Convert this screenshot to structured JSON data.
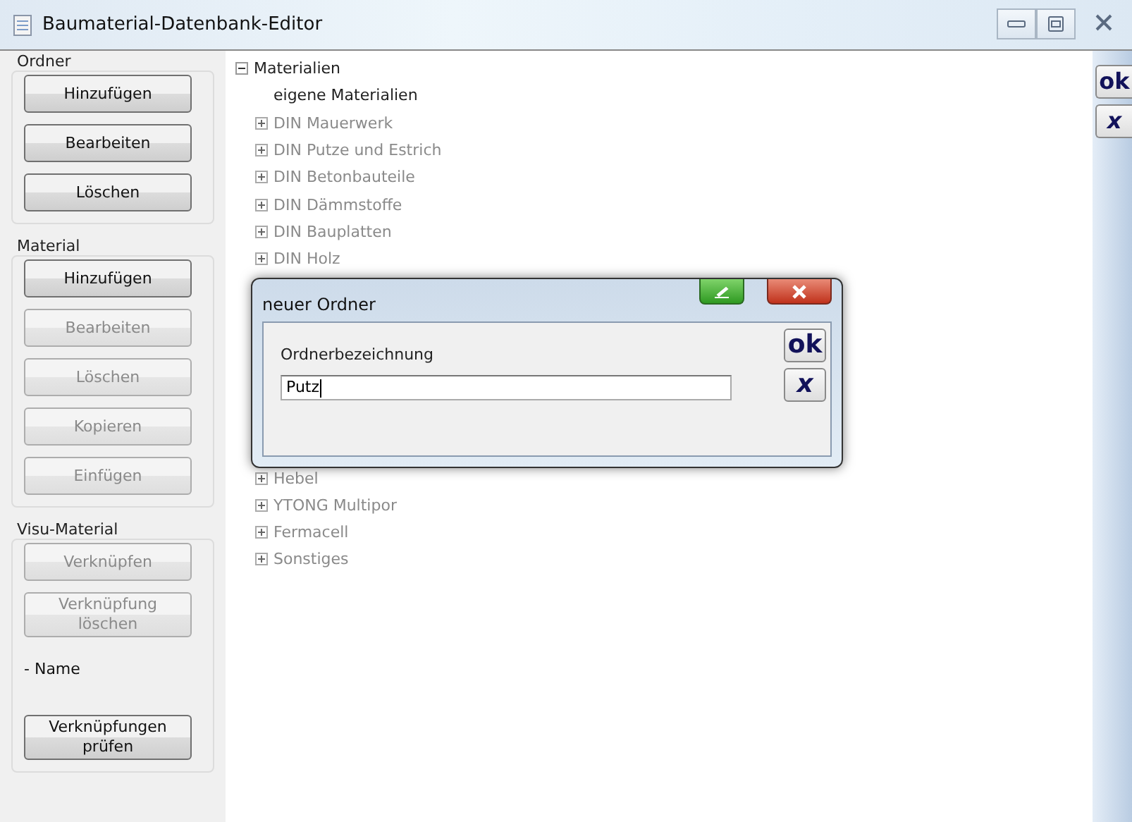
{
  "window": {
    "title": "Baumaterial-Datenbank-Editor"
  },
  "sidebar": {
    "sections": [
      {
        "title": "Ordner",
        "items": [
          {
            "kind": "button",
            "label": "Hinzufügen",
            "disabled": false
          },
          {
            "kind": "button",
            "label": "Bearbeiten",
            "disabled": false
          },
          {
            "kind": "button",
            "label": "Löschen",
            "disabled": false
          }
        ]
      },
      {
        "title": "Material",
        "items": [
          {
            "kind": "button",
            "label": "Hinzufügen",
            "disabled": false
          },
          {
            "kind": "button",
            "label": "Bearbeiten",
            "disabled": true
          },
          {
            "kind": "button",
            "label": "Löschen",
            "disabled": true
          },
          {
            "kind": "button",
            "label": "Kopieren",
            "disabled": true
          },
          {
            "kind": "button",
            "label": "Einfügen",
            "disabled": true
          }
        ]
      },
      {
        "title": "Visu-Material",
        "items": [
          {
            "kind": "button",
            "label": "Verknüpfen",
            "disabled": true
          },
          {
            "kind": "button",
            "label": "Verknüpfung löschen",
            "disabled": true
          },
          {
            "kind": "label",
            "label": "- Name"
          },
          {
            "kind": "button",
            "label": "Verknüpfungen prüfen",
            "disabled": false
          }
        ]
      }
    ]
  },
  "tree": {
    "label": "Materialien",
    "expanded": true,
    "children": [
      {
        "label": "eigene Materialien",
        "disabled": false
      },
      {
        "label": "DIN Mauerwerk",
        "disabled": true,
        "expanded": false
      },
      {
        "label": "DIN Putze und Estrich",
        "disabled": true,
        "expanded": false
      },
      {
        "label": "DIN Betonbauteile",
        "disabled": true,
        "expanded": false
      },
      {
        "label": "DIN Dämmstoffe",
        "disabled": true,
        "expanded": false
      },
      {
        "label": "DIN Bauplatten",
        "disabled": true,
        "expanded": false
      },
      {
        "label": "DIN Holz",
        "disabled": true,
        "expanded": false
      },
      {
        "label": "Hebel",
        "disabled": true,
        "expanded": false
      },
      {
        "label": "YTONG Multipor",
        "disabled": true,
        "expanded": false
      },
      {
        "label": "Fermacell",
        "disabled": true,
        "expanded": false
      },
      {
        "label": "Sonstiges",
        "disabled": true,
        "expanded": false
      }
    ]
  },
  "side_buttons": {
    "ok": "ok",
    "cancel": "x"
  },
  "dialog": {
    "title": "neuer Ordner",
    "field_label": "Ordnerbezeichnung",
    "value": "Putz",
    "ok": "ok",
    "cancel": "x"
  }
}
